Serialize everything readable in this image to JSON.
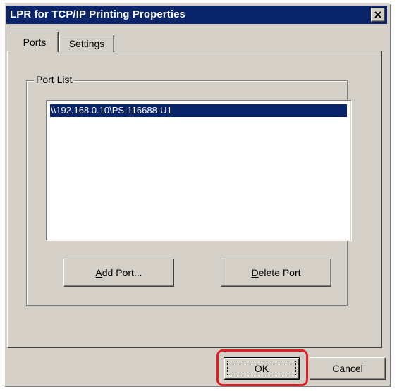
{
  "window": {
    "title": "LPR for TCP/IP Printing Properties",
    "close_icon": "close-icon"
  },
  "tabs": [
    {
      "label": "Ports",
      "selected": true
    },
    {
      "label": "Settings",
      "selected": false
    }
  ],
  "port_list": {
    "group_label": "Port List",
    "items": [
      "\\\\192.168.0.10\\PS-116688-U1"
    ],
    "selected_index": 0
  },
  "buttons": {
    "add_port": {
      "accel": "A",
      "rest": "dd Port..."
    },
    "delete_port": {
      "accel": "D",
      "rest": "elete Port"
    },
    "ok": "OK",
    "cancel": "Cancel"
  },
  "colors": {
    "titlebar": "#0a246a",
    "selection": "#0a246a",
    "highlight": "#e31b23",
    "face": "#d4d0c8"
  }
}
